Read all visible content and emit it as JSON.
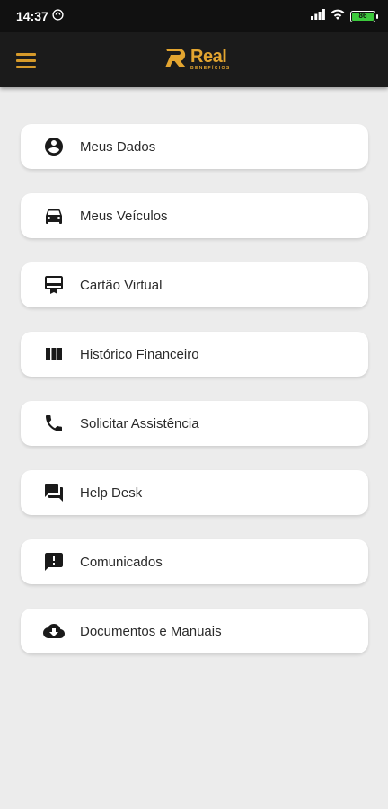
{
  "status_bar": {
    "time": "14:37",
    "battery_level": "86",
    "battery_color": "#3cc93c"
  },
  "app_bar": {
    "background": "#1b1b1b",
    "accent": "#d69a2a",
    "logo_word": "Real",
    "logo_subtitle": "BENEFÍCIOS"
  },
  "menu": {
    "items": [
      {
        "label": "Meus Dados",
        "icon": "account-circle-icon"
      },
      {
        "label": "Meus Veículos",
        "icon": "car-icon"
      },
      {
        "label": "Cartão Virtual",
        "icon": "card-membership-icon"
      },
      {
        "label": "Histórico Financeiro",
        "icon": "view-column-icon"
      },
      {
        "label": "Solicitar Assistência",
        "icon": "phone-icon"
      },
      {
        "label": "Help Desk",
        "icon": "chat-icon"
      },
      {
        "label": "Comunicados",
        "icon": "announcement-icon"
      },
      {
        "label": "Documentos e Manuais",
        "icon": "cloud-download-icon"
      }
    ]
  }
}
